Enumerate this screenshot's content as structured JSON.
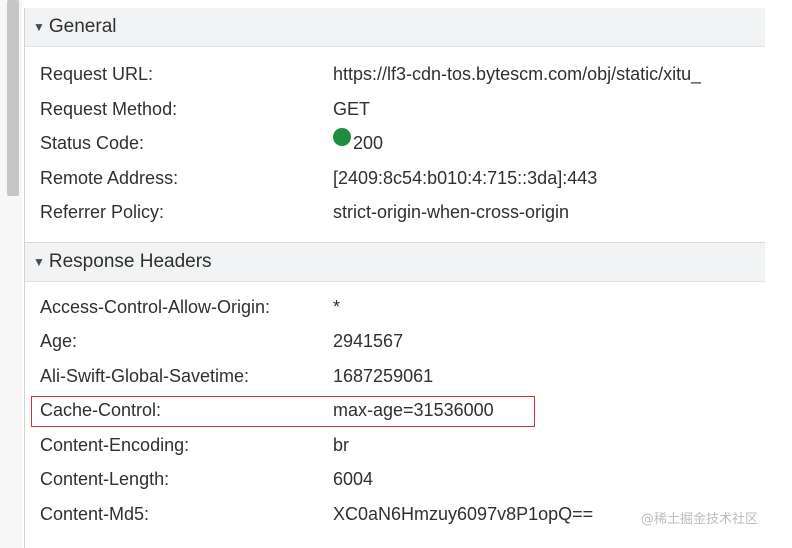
{
  "general": {
    "title": "General",
    "rows": [
      {
        "key": "Request URL:",
        "value": "https://lf3-cdn-tos.bytescm.com/obj/static/xitu_"
      },
      {
        "key": "Request Method:",
        "value": "GET"
      },
      {
        "key": "Status Code:",
        "value": "200"
      },
      {
        "key": "Remote Address:",
        "value": "[2409:8c54:b010:4:715::3da]:443"
      },
      {
        "key": "Referrer Policy:",
        "value": "strict-origin-when-cross-origin"
      }
    ]
  },
  "response_headers": {
    "title": "Response Headers",
    "rows": [
      {
        "key": "Access-Control-Allow-Origin:",
        "value": "*"
      },
      {
        "key": "Age:",
        "value": "2941567"
      },
      {
        "key": "Ali-Swift-Global-Savetime:",
        "value": "1687259061"
      },
      {
        "key": "Cache-Control:",
        "value": "max-age=31536000"
      },
      {
        "key": "Content-Encoding:",
        "value": "br"
      },
      {
        "key": "Content-Length:",
        "value": "6004"
      },
      {
        "key": "Content-Md5:",
        "value": "XC0aN6Hmzuy6097v8P1opQ=="
      }
    ]
  },
  "status_dot_color": "#1e8e3e",
  "highlight_color": "#d0343b",
  "watermark": "@稀土掘金技术社区"
}
